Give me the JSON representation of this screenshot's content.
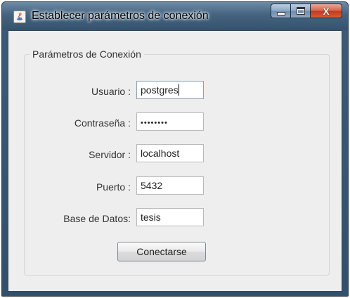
{
  "window": {
    "title": "Establecer parámetros de conexión",
    "controls": {
      "minimize_icon": "minimize-icon",
      "maximize_icon": "maximize-icon",
      "close_glyph": "X"
    }
  },
  "panel": {
    "legend": "Parámetros de Conexión"
  },
  "fields": {
    "user": {
      "label": "Usuario :",
      "value": "postgres"
    },
    "password": {
      "label": "Contraseña :",
      "value": "••••••••"
    },
    "server": {
      "label": "Servidor :",
      "value": "localhost"
    },
    "port": {
      "label": "Puerto :",
      "value": "5432"
    },
    "database": {
      "label": "Base de Datos:",
      "value": "tesis"
    }
  },
  "buttons": {
    "connect": "Conectarse"
  },
  "colors": {
    "window_background": "#eeeeee",
    "frame": "#35536f",
    "close_button": "#c23a1f"
  }
}
